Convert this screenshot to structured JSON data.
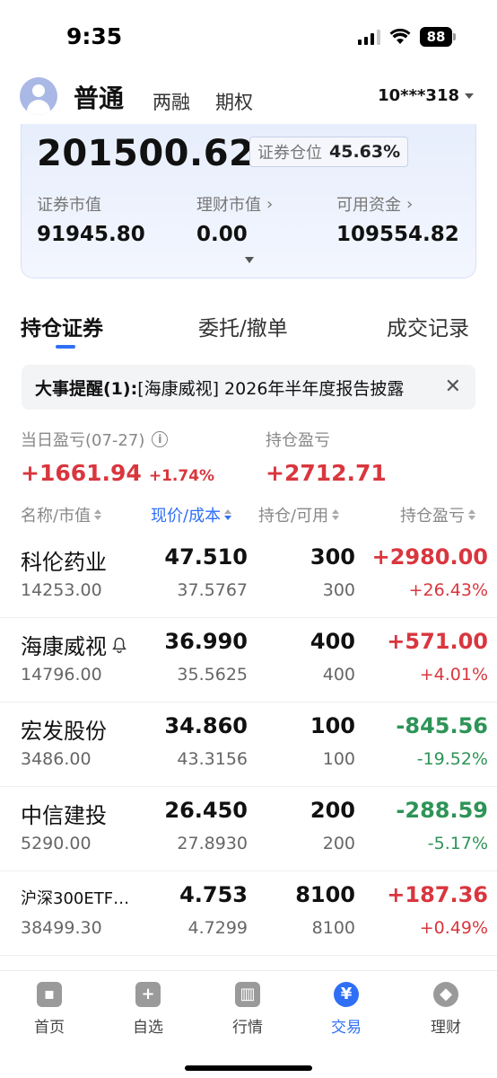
{
  "status_bar": {
    "time": "9:35",
    "battery": "88"
  },
  "account": {
    "tabs": [
      "普通",
      "两融",
      "期权"
    ],
    "account_number": "10***318"
  },
  "assets": {
    "total": "201500.62",
    "position_ratio_label": "证券仓位",
    "position_ratio_value": "45.63%",
    "metrics": [
      {
        "label": "证券市值",
        "value": "91945.80"
      },
      {
        "label": "理财市值",
        "value": "0.00"
      },
      {
        "label": "可用资金",
        "value": "109554.82"
      }
    ]
  },
  "tabs": [
    "持仓证券",
    "委托/撤单",
    "成交记录"
  ],
  "notice": {
    "head": "大事提醒(1):",
    "body": "[海康威视] 2026年半年度报告披露"
  },
  "pnl": {
    "daily_label": "当日盈亏(07-27)",
    "daily_value": "+1661.94",
    "daily_pct": "+1.74%",
    "hold_label": "持仓盈亏",
    "hold_value": "+2712.71"
  },
  "columns": [
    "名称/市值",
    "现价/成本",
    "持仓/可用",
    "持仓盈亏"
  ],
  "holdings": [
    {
      "name": "科伦药业",
      "market_value": "14253.00",
      "price": "47.510",
      "cost": "37.5767",
      "hold": "300",
      "available": "300",
      "pl": "+2980.00",
      "pl_pct": "+26.43%",
      "dir": "up"
    },
    {
      "name": "海康威视",
      "market_value": "14796.00",
      "price": "36.990",
      "cost": "35.5625",
      "hold": "400",
      "available": "400",
      "pl": "+571.00",
      "pl_pct": "+4.01%",
      "dir": "up"
    },
    {
      "name": "宏发股份",
      "market_value": "3486.00",
      "price": "34.860",
      "cost": "43.3156",
      "hold": "100",
      "available": "100",
      "pl": "-845.56",
      "pl_pct": "-19.52%",
      "dir": "down"
    },
    {
      "name": "中信建投",
      "market_value": "5290.00",
      "price": "26.450",
      "cost": "27.8930",
      "hold": "200",
      "available": "200",
      "pl": "-288.59",
      "pl_pct": "-5.17%",
      "dir": "down"
    },
    {
      "name": "沪深300ETF…",
      "market_value": "38499.30",
      "price": "4.753",
      "cost": "4.7299",
      "hold": "8100",
      "available": "8100",
      "pl": "+187.36",
      "pl_pct": "+0.49%",
      "dir": "up"
    }
  ],
  "bottom_nav": [
    {
      "label": "首页",
      "icon": "home-icon"
    },
    {
      "label": "自选",
      "icon": "plus-icon"
    },
    {
      "label": "行情",
      "icon": "chart-icon"
    },
    {
      "label": "交易",
      "icon": "yen-icon"
    },
    {
      "label": "理财",
      "icon": "diamond-icon"
    }
  ],
  "colors": {
    "accent": "#2f6ff5",
    "up": "#d9363e",
    "down": "#2e9457"
  }
}
